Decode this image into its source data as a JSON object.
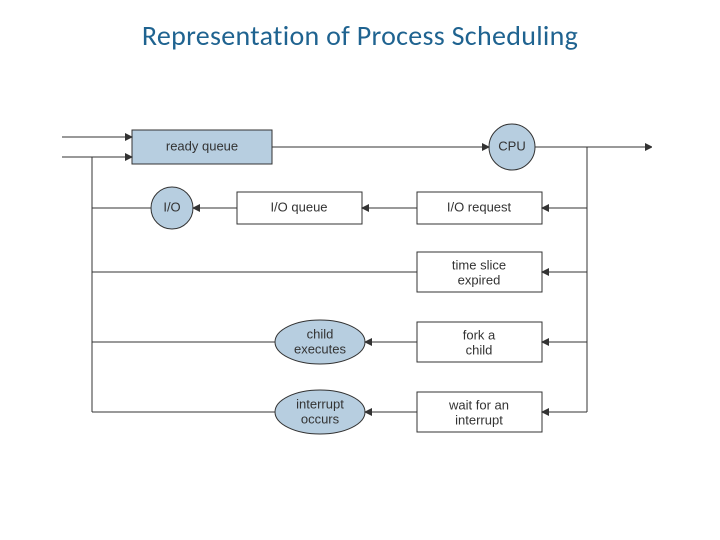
{
  "title": "Representation of Process Scheduling",
  "nodes": {
    "ready_queue": "ready queue",
    "cpu": "CPU",
    "io": "I/O",
    "io_queue": "I/O queue",
    "io_request": "I/O request",
    "time_slice_l1": "time slice",
    "time_slice_l2": "expired",
    "child_l1": "child",
    "child_l2": "executes",
    "fork_l1": "fork a",
    "fork_l2": "child",
    "intr_l1": "interrupt",
    "intr_l2": "occurs",
    "wait_l1": "wait for an",
    "wait_l2": "interrupt"
  }
}
